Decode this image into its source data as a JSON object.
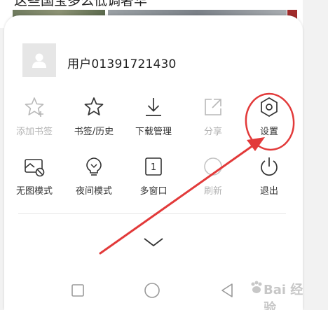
{
  "background": {
    "headline": "这些国宝多么低调奢华"
  },
  "user": {
    "name": "用户01391721430",
    "avatar_icon": "person-icon"
  },
  "menu": {
    "row1": [
      {
        "label": "添加书签",
        "icon": "star-plus-icon",
        "enabled": false
      },
      {
        "label": "书签/历史",
        "icon": "star-icon",
        "enabled": true
      },
      {
        "label": "下载管理",
        "icon": "download-icon",
        "enabled": true
      },
      {
        "label": "分享",
        "icon": "share-icon",
        "enabled": false
      },
      {
        "label": "设置",
        "icon": "settings-hexagon-icon",
        "enabled": true
      }
    ],
    "row2": [
      {
        "label": "无图模式",
        "icon": "no-image-icon",
        "enabled": true
      },
      {
        "label": "夜间模式",
        "icon": "bulb-icon",
        "enabled": true
      },
      {
        "label": "多窗口",
        "icon": "window-count-icon",
        "enabled": true,
        "count": "1"
      },
      {
        "label": "刷新",
        "icon": "refresh-icon",
        "enabled": false
      },
      {
        "label": "退出",
        "icon": "power-icon",
        "enabled": true
      }
    ]
  },
  "collapse": {
    "icon": "chevron-down-icon"
  },
  "navbar": {
    "recents_icon": "square-icon",
    "home_icon": "circle-icon",
    "back_icon": "triangle-back-icon"
  },
  "annotation_color": "#e23a3a",
  "watermark": {
    "text": "Bai 经验"
  }
}
